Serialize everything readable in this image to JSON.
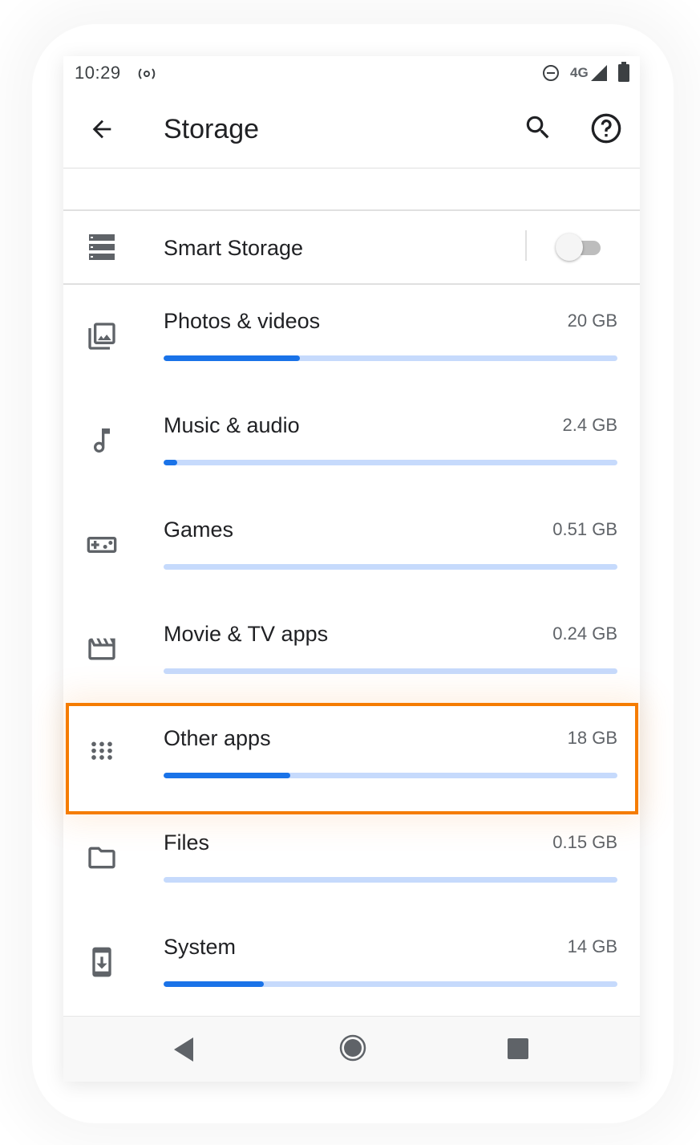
{
  "status_bar": {
    "time": "10:29",
    "network": "4G",
    "icons": [
      "cast-icon",
      "do-not-disturb-icon",
      "signal-icon",
      "battery-icon"
    ]
  },
  "app_bar": {
    "title": "Storage",
    "icons": [
      "back-arrow-icon",
      "search-icon",
      "help-icon"
    ]
  },
  "smart_storage": {
    "label": "Smart Storage",
    "enabled": false,
    "icon": "storage-icon"
  },
  "categories": [
    {
      "label": "Photos & videos",
      "size": "20 GB",
      "usage_fraction": 0.3,
      "icon": "photo-library-icon"
    },
    {
      "label": "Music & audio",
      "size": "2.4 GB",
      "usage_fraction": 0.03,
      "icon": "music-note-icon"
    },
    {
      "label": "Games",
      "size": "0.51 GB",
      "usage_fraction": 0.0,
      "icon": "gamepad-icon"
    },
    {
      "label": "Movie & TV apps",
      "size": "0.24 GB",
      "usage_fraction": 0.0,
      "icon": "movie-icon"
    },
    {
      "label": "Other apps",
      "size": "18 GB",
      "usage_fraction": 0.28,
      "icon": "apps-grid-icon",
      "highlighted": true
    },
    {
      "label": "Files",
      "size": "0.15 GB",
      "usage_fraction": 0.0,
      "icon": "folder-icon"
    },
    {
      "label": "System",
      "size": "14 GB",
      "usage_fraction": 0.22,
      "icon": "system-update-icon"
    }
  ],
  "nav_bar": {
    "icons": [
      "nav-back-icon",
      "nav-home-icon",
      "nav-recents-icon"
    ]
  },
  "colors": {
    "accent": "#1a73e8",
    "bar_track": "#c6dafc",
    "highlight": "#f57c00",
    "text_primary": "#202124",
    "text_secondary": "#5f6368"
  }
}
